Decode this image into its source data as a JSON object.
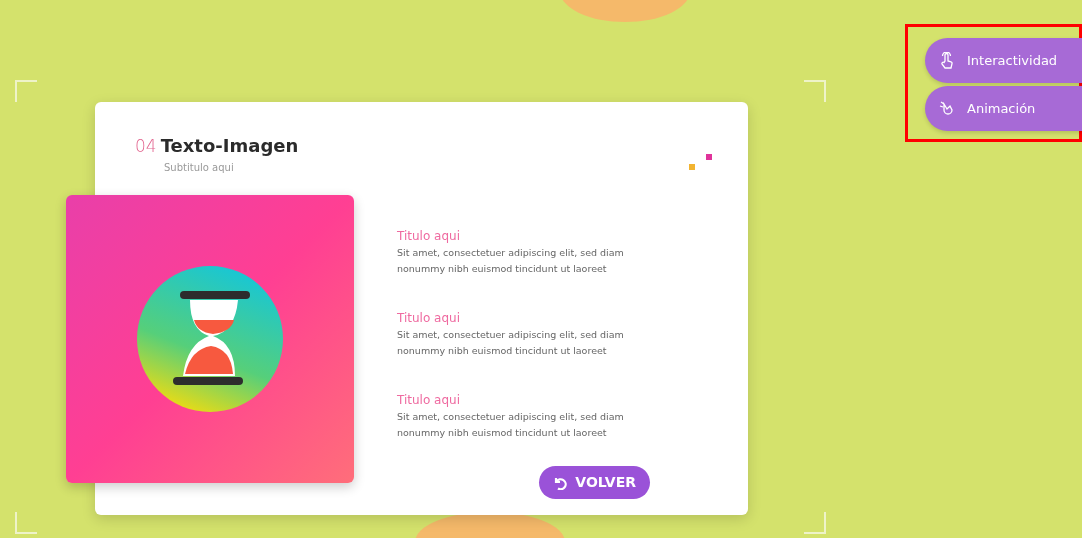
{
  "header": {
    "number": "04",
    "title": "Texto-Imagen",
    "subtitle": "Subtitulo aqui"
  },
  "items": [
    {
      "title": "Titulo aqui",
      "text": "Sit amet, consectetuer adipiscing elit, sed diam nonummy nibh euismod tincidunt ut laoreet"
    },
    {
      "title": "Titulo aqui",
      "text": "Sit amet, consectetuer adipiscing elit, sed diam nonummy nibh euismod tincidunt ut laoreet"
    },
    {
      "title": "Titulo aqui",
      "text": "Sit amet, consectetuer adipiscing elit, sed diam nonummy nibh euismod tincidunt ut laoreet"
    }
  ],
  "back_button": {
    "label": "VOLVER"
  },
  "side_menu": {
    "highlighted": true,
    "items": [
      {
        "kind": "touch",
        "label": "Interactividad"
      },
      {
        "kind": "motion",
        "label": "Animación"
      }
    ]
  }
}
